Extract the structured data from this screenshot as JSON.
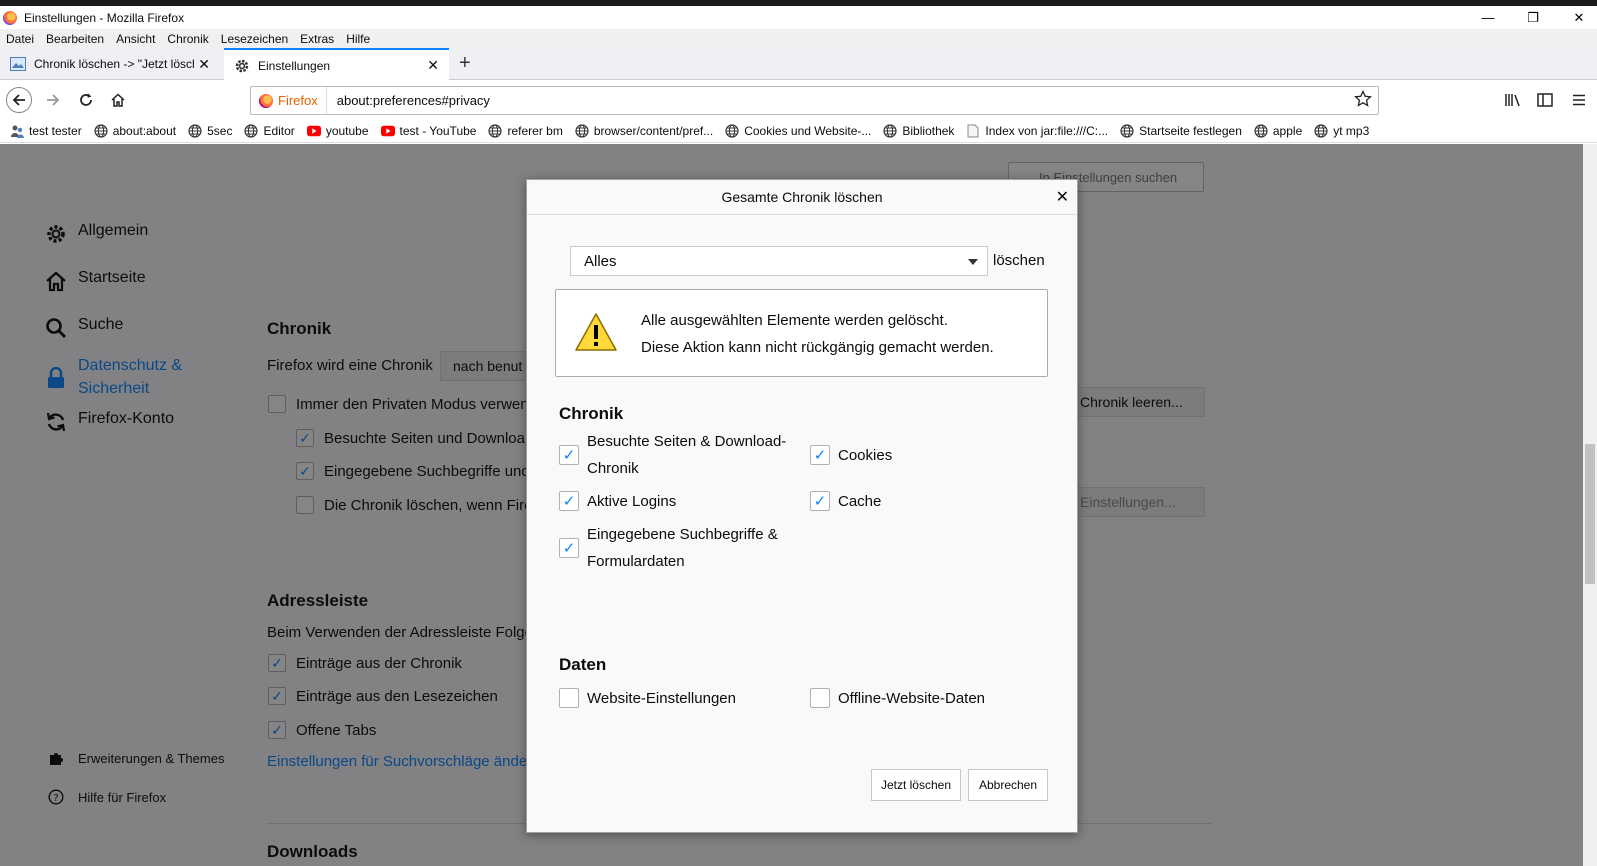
{
  "window": {
    "title": "Einstellungen - Mozilla Firefox",
    "controls": {
      "minimize": "—",
      "restore": "❐",
      "close": "✕"
    }
  },
  "menubar": [
    "Datei",
    "Bearbeiten",
    "Ansicht",
    "Chronik",
    "Lesezeichen",
    "Extras",
    "Hilfe"
  ],
  "tabs": [
    {
      "label": "Chronik löschen -> \"Jetzt lösch",
      "icon": "image-icon"
    },
    {
      "label": "Einstellungen",
      "icon": "gear-icon",
      "active": true
    }
  ],
  "urlbar": {
    "identity": "Firefox",
    "url": "about:preferences#privacy"
  },
  "bookmarks": [
    {
      "label": "test tester",
      "icon": "people-icon"
    },
    {
      "label": "about:about",
      "icon": "globe-icon"
    },
    {
      "label": "5sec",
      "icon": "globe-icon"
    },
    {
      "label": "Editor",
      "icon": "globe-icon"
    },
    {
      "label": "youtube",
      "icon": "youtube-icon"
    },
    {
      "label": "test - YouTube",
      "icon": "youtube-icon"
    },
    {
      "label": "referer bm",
      "icon": "globe-icon"
    },
    {
      "label": "browser/content/pref...",
      "icon": "globe-icon"
    },
    {
      "label": "Cookies und Website-...",
      "icon": "globe-icon"
    },
    {
      "label": "Bibliothek",
      "icon": "globe-icon"
    },
    {
      "label": "Index von jar:file:///C:...",
      "icon": "page-icon"
    },
    {
      "label": "Startseite festlegen",
      "icon": "globe-icon"
    },
    {
      "label": "apple",
      "icon": "globe-icon"
    },
    {
      "label": "yt mp3",
      "icon": "globe-icon"
    }
  ],
  "sidebar": {
    "items": [
      {
        "label": "Allgemein",
        "icon": "gear-icon"
      },
      {
        "label": "Startseite",
        "icon": "home-icon"
      },
      {
        "label": "Suche",
        "icon": "search-icon"
      },
      {
        "label": "Datenschutz &",
        "label2": "Sicherheit",
        "icon": "lock-icon"
      },
      {
        "label": "Firefox-Konto",
        "icon": "sync-icon"
      }
    ],
    "bottom": [
      {
        "label": "Erweiterungen & Themes",
        "icon": "puzzle-icon"
      },
      {
        "label": "Hilfe für Firefox",
        "icon": "help-icon"
      }
    ]
  },
  "prefs": {
    "search_placeholder": "In Einstellungen suchen",
    "chronik": {
      "heading": "Chronik",
      "intro": "Firefox wird eine Chronik",
      "mode": "nach benut",
      "clear_button": "Chronik leeren...",
      "settings_button": "Einstellungen...",
      "options": [
        {
          "label": "Immer den Privaten Modus verwen",
          "checked": false
        },
        {
          "label": "Besuchte Seiten und Downloa",
          "checked": true
        },
        {
          "label": "Eingegebene Suchbegriffe und",
          "checked": true
        },
        {
          "label": "Die Chronik löschen, wenn Fire",
          "checked": false
        }
      ]
    },
    "adressleiste": {
      "heading": "Adressleiste",
      "intro": "Beim Verwenden der Adressleiste Folge",
      "options": [
        {
          "label": "Einträge aus der Chronik",
          "checked": true
        },
        {
          "label": "Einträge aus den Lesezeichen",
          "checked": true
        },
        {
          "label": "Offene Tabs",
          "checked": true
        }
      ],
      "link": "Einstellungen für Suchvorschläge änder"
    },
    "next_heading": "Downloads"
  },
  "dialog": {
    "title": "Gesamte Chronik löschen",
    "range_value": "Alles",
    "range_suffix": "löschen",
    "warning_line1": "Alle ausgewählten Elemente werden gelöscht.",
    "warning_line2": "Diese Aktion kann nicht rückgängig gemacht werden.",
    "chronik_heading": "Chronik",
    "chronik_items": [
      {
        "label": "Besuchte Seiten & Download-",
        "label2": "Chronik",
        "checked": true
      },
      {
        "label": "Cookies",
        "checked": true
      },
      {
        "label": "Aktive Logins",
        "checked": true
      },
      {
        "label": "Cache",
        "checked": true
      },
      {
        "label": "Eingegebene Suchbegriffe &",
        "label2": "Formulardaten",
        "checked": true
      }
    ],
    "daten_heading": "Daten",
    "daten_items": [
      {
        "label": "Website-Einstellungen",
        "checked": false
      },
      {
        "label": "Offline-Website-Daten",
        "checked": false
      }
    ],
    "confirm_button": "Jetzt löschen",
    "cancel_button": "Abbrechen",
    "close_glyph": "✕",
    "check_glyph": "✓"
  }
}
